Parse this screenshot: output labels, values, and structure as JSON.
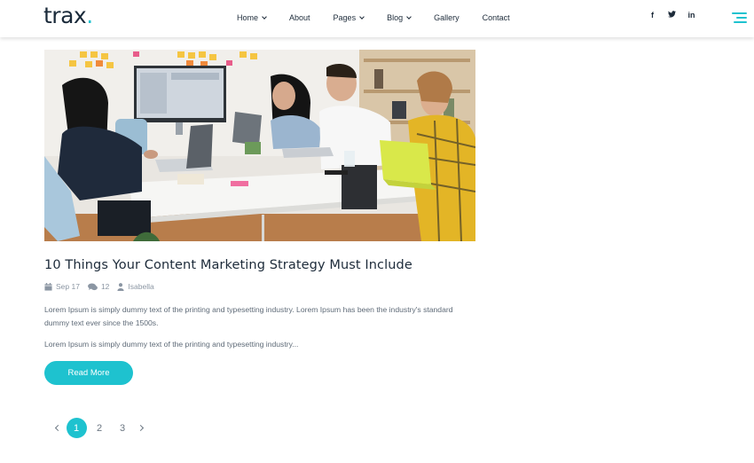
{
  "brand": {
    "name": "trax",
    "dot": ".",
    "accent_color": "#1ec2cf"
  },
  "nav": {
    "items": [
      {
        "label": "Home",
        "has_dropdown": true
      },
      {
        "label": "About",
        "has_dropdown": false
      },
      {
        "label": "Pages",
        "has_dropdown": true
      },
      {
        "label": "Blog",
        "has_dropdown": true
      },
      {
        "label": "Gallery",
        "has_dropdown": false
      },
      {
        "label": "Contact",
        "has_dropdown": false
      }
    ]
  },
  "social": {
    "facebook": "f",
    "twitter_icon": "twitter-icon",
    "linkedin": "in"
  },
  "post": {
    "image_icon": "meeting-room-photo",
    "title": "10 Things Your Content Marketing Strategy Must Include",
    "date": "Sep 17",
    "comments": "12",
    "author": "Isabella",
    "excerpt_1": "Lorem Ipsum is simply dummy text of the printing and typesetting industry. Lorem Ipsum has been the industry's standard dummy text ever since the 1500s.",
    "excerpt_2": "Lorem Ipsum is simply dummy text of the printing and typesetting industry...",
    "read_more": "Read More"
  },
  "pagination": {
    "pages": [
      "1",
      "2",
      "3"
    ],
    "active": "1"
  }
}
